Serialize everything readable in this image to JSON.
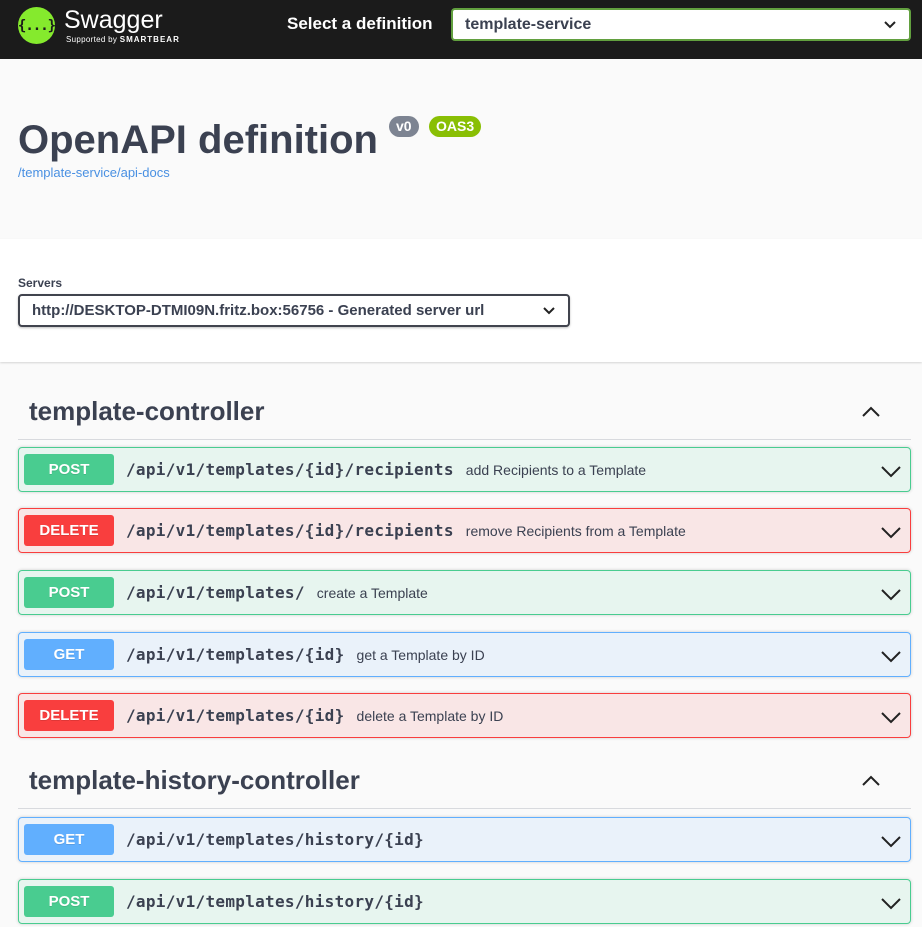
{
  "topbar": {
    "logo_icon": "{...}",
    "logo_name": "Swagger",
    "logo_sub_prefix": "Supported by",
    "logo_sub_brand": "SMARTBEAR",
    "definition_label": "Select a definition",
    "definition_value": "template-service"
  },
  "info": {
    "title": "OpenAPI definition",
    "version_badge": "v0",
    "oas_badge": "OAS3",
    "link": "/template-service/api-docs"
  },
  "servers": {
    "label": "Servers",
    "selected": "http://DESKTOP-DTMI09N.fritz.box:56756 - Generated server url"
  },
  "tags": [
    {
      "name": "template-controller",
      "operations": [
        {
          "method": "POST",
          "path": "/api/v1/templates/{id}/recipients",
          "summary": "add Recipients to a Template"
        },
        {
          "method": "DELETE",
          "path": "/api/v1/templates/{id}/recipients",
          "summary": "remove Recipients from a Template"
        },
        {
          "method": "POST",
          "path": "/api/v1/templates/",
          "summary": "create a Template"
        },
        {
          "method": "GET",
          "path": "/api/v1/templates/{id}",
          "summary": "get a Template by ID"
        },
        {
          "method": "DELETE",
          "path": "/api/v1/templates/{id}",
          "summary": "delete a Template by ID"
        }
      ]
    },
    {
      "name": "template-history-controller",
      "operations": [
        {
          "method": "GET",
          "path": "/api/v1/templates/history/{id}",
          "summary": ""
        },
        {
          "method": "POST",
          "path": "/api/v1/templates/history/{id}",
          "summary": ""
        }
      ]
    }
  ],
  "colors": {
    "post": "#49cc90",
    "delete": "#f93e3e",
    "get": "#61affe",
    "brand": "#85ea2d"
  }
}
